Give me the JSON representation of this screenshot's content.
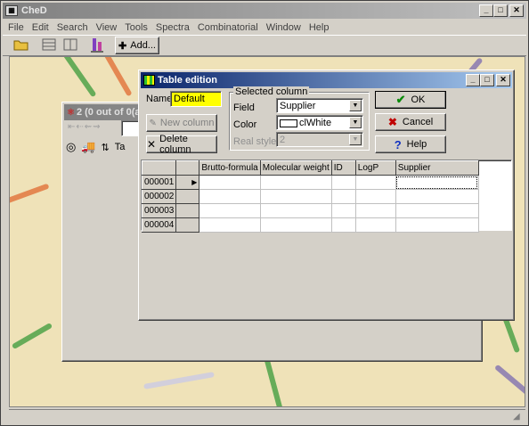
{
  "app": {
    "title": "CheD",
    "menu": [
      "File",
      "Edit",
      "Search",
      "View",
      "Tools",
      "Spectra",
      "Combinatorial",
      "Window",
      "Help"
    ],
    "toolbar": {
      "add_label": "Add..."
    }
  },
  "child_window": {
    "title": "2 (0 out of 0(a",
    "nav_label": "Ta"
  },
  "dialog": {
    "title": "Table edition",
    "name_label": "Name",
    "name_value": "Default",
    "new_column_label": "New column",
    "delete_column_label": "Delete column",
    "selected_column_group": "Selected column",
    "field_label": "Field",
    "field_value": "Supplier",
    "color_label": "Color",
    "color_value": "clWhite",
    "real_style_label": "Real style",
    "real_style_value": "2",
    "ok_label": "OK",
    "cancel_label": "Cancel",
    "help_label": "Help",
    "grid": {
      "columns": [
        "Brutto-formula",
        "Molecular weight",
        "ID",
        "LogP",
        "Supplier"
      ],
      "rows": [
        "000001",
        "000002",
        "000003",
        "000004"
      ],
      "current_row_marker": "▶"
    }
  },
  "colors": {
    "title_active": "#0a246a",
    "name_field_bg": "#ffff00",
    "ok_check": "#0a8a0a",
    "cancel_x": "#c00000",
    "help_q": "#1030c0"
  }
}
